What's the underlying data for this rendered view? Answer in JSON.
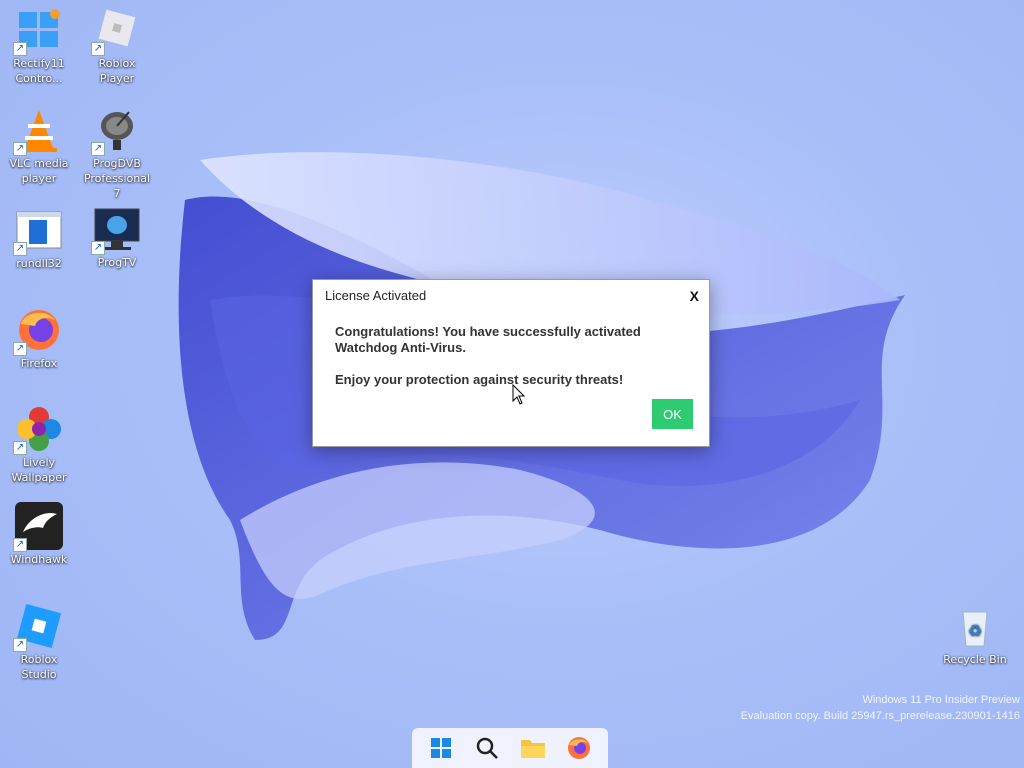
{
  "desktop": {
    "icons": [
      {
        "id": "rectify11",
        "label": "Rectify11 Contro..."
      },
      {
        "id": "roblox-player",
        "label": "Roblox Player"
      },
      {
        "id": "vlc",
        "label": "VLC media player"
      },
      {
        "id": "progdvb",
        "label": "ProgDVB Professional 7"
      },
      {
        "id": "rundll32",
        "label": "rundll32"
      },
      {
        "id": "progtv",
        "label": "ProgTV"
      },
      {
        "id": "firefox",
        "label": "Firefox"
      },
      {
        "id": "lively",
        "label": "Lively Wallpaper"
      },
      {
        "id": "windhawk",
        "label": "Windhawk"
      },
      {
        "id": "roblox-studio",
        "label": "Roblox Studio"
      },
      {
        "id": "recycle-bin",
        "label": "Recycle Bin"
      }
    ]
  },
  "dialog": {
    "title": "License Activated",
    "close_label": "X",
    "message_line1": "Congratulations! You have successfully activated Watchdog Anti-Virus.",
    "message_line2": "Enjoy your protection against security threats!",
    "ok_label": "OK",
    "ok_color": "#2ecc71"
  },
  "watermark": {
    "line1": "Windows 11 Pro Insider Preview",
    "line2": "Evaluation copy. Build 25947.rs_prerelease.230901-1416"
  },
  "taskbar": {
    "items": [
      {
        "icon": "start-icon"
      },
      {
        "icon": "search-icon"
      },
      {
        "icon": "file-explorer-icon"
      },
      {
        "icon": "firefox-icon"
      }
    ]
  },
  "colors": {
    "wallpaper": "#a9bff8",
    "bloom_dark": "#4a56d8",
    "bloom_light": "#c8d2ff"
  }
}
